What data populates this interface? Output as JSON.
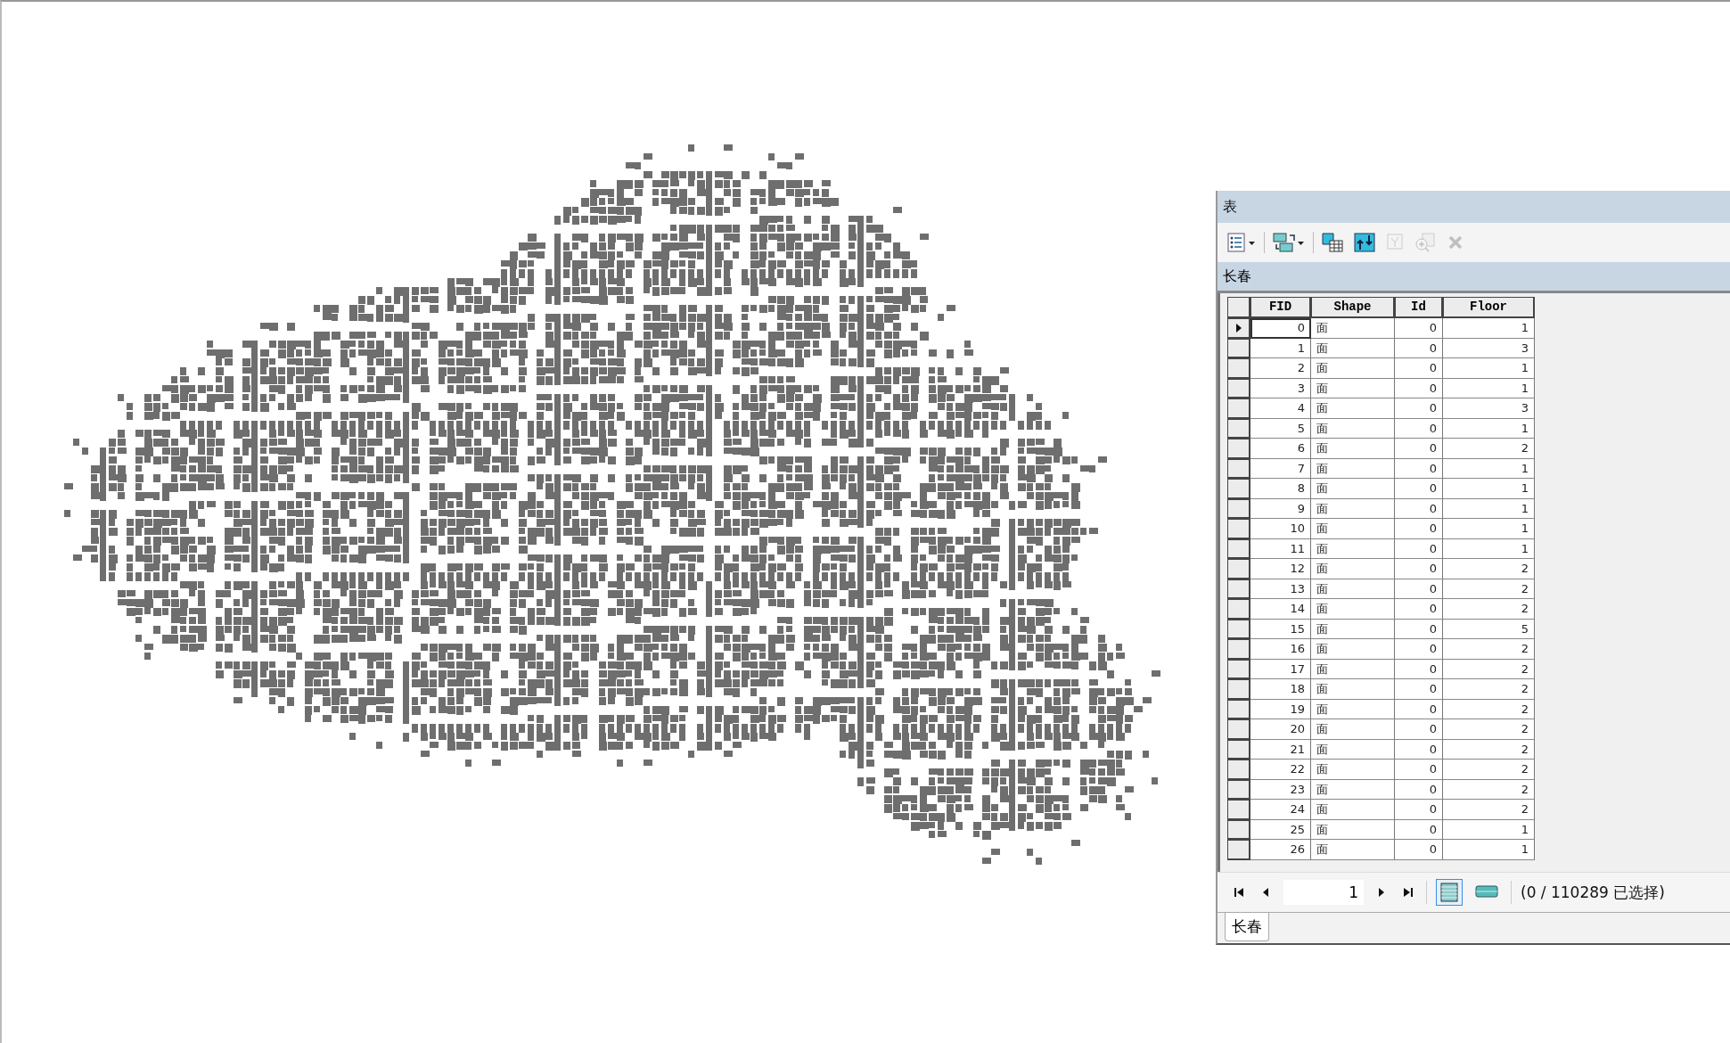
{
  "table_window": {
    "title": "表",
    "toolbar": [
      {
        "kind": "options",
        "disabled": false
      },
      {
        "kind": "related",
        "disabled": false
      },
      {
        "kind": "select_by_attributes",
        "disabled": false
      },
      {
        "kind": "switch_selection",
        "disabled": false
      },
      {
        "kind": "clear_selection",
        "disabled": true
      },
      {
        "kind": "zoom_selected",
        "disabled": true
      },
      {
        "kind": "delete_selected",
        "disabled": true
      }
    ],
    "table_name": "长春",
    "columns": [
      "FID",
      "Shape",
      "Id",
      "Floor"
    ],
    "rows": [
      {
        "fid": "0",
        "shape": "面",
        "id": "0",
        "floor": "1",
        "selected": true
      },
      {
        "fid": "1",
        "shape": "面",
        "id": "0",
        "floor": "3",
        "selected": false
      },
      {
        "fid": "2",
        "shape": "面",
        "id": "0",
        "floor": "1",
        "selected": false
      },
      {
        "fid": "3",
        "shape": "面",
        "id": "0",
        "floor": "1",
        "selected": false
      },
      {
        "fid": "4",
        "shape": "面",
        "id": "0",
        "floor": "3",
        "selected": false
      },
      {
        "fid": "5",
        "shape": "面",
        "id": "0",
        "floor": "1",
        "selected": false
      },
      {
        "fid": "6",
        "shape": "面",
        "id": "0",
        "floor": "2",
        "selected": false
      },
      {
        "fid": "7",
        "shape": "面",
        "id": "0",
        "floor": "1",
        "selected": false
      },
      {
        "fid": "8",
        "shape": "面",
        "id": "0",
        "floor": "1",
        "selected": false
      },
      {
        "fid": "9",
        "shape": "面",
        "id": "0",
        "floor": "1",
        "selected": false
      },
      {
        "fid": "10",
        "shape": "面",
        "id": "0",
        "floor": "1",
        "selected": false
      },
      {
        "fid": "11",
        "shape": "面",
        "id": "0",
        "floor": "1",
        "selected": false
      },
      {
        "fid": "12",
        "shape": "面",
        "id": "0",
        "floor": "2",
        "selected": false
      },
      {
        "fid": "13",
        "shape": "面",
        "id": "0",
        "floor": "2",
        "selected": false
      },
      {
        "fid": "14",
        "shape": "面",
        "id": "0",
        "floor": "2",
        "selected": false
      },
      {
        "fid": "15",
        "shape": "面",
        "id": "0",
        "floor": "5",
        "selected": false
      },
      {
        "fid": "16",
        "shape": "面",
        "id": "0",
        "floor": "2",
        "selected": false
      },
      {
        "fid": "17",
        "shape": "面",
        "id": "0",
        "floor": "2",
        "selected": false
      },
      {
        "fid": "18",
        "shape": "面",
        "id": "0",
        "floor": "2",
        "selected": false
      },
      {
        "fid": "19",
        "shape": "面",
        "id": "0",
        "floor": "2",
        "selected": false
      },
      {
        "fid": "20",
        "shape": "面",
        "id": "0",
        "floor": "2",
        "selected": false
      },
      {
        "fid": "21",
        "shape": "面",
        "id": "0",
        "floor": "2",
        "selected": false
      },
      {
        "fid": "22",
        "shape": "面",
        "id": "0",
        "floor": "2",
        "selected": false
      },
      {
        "fid": "23",
        "shape": "面",
        "id": "0",
        "floor": "2",
        "selected": false
      },
      {
        "fid": "24",
        "shape": "面",
        "id": "0",
        "floor": "2",
        "selected": false
      },
      {
        "fid": "25",
        "shape": "面",
        "id": "0",
        "floor": "1",
        "selected": false
      },
      {
        "fid": "26",
        "shape": "面",
        "id": "0",
        "floor": "1",
        "selected": false
      }
    ],
    "record_field": {
      "value": "1"
    },
    "views": [
      {
        "kind": "all",
        "selected": true
      },
      {
        "kind": "selected",
        "selected": false
      }
    ],
    "status": "(0 / 110289 已选择)",
    "tabs": [
      {
        "label": "长春",
        "selected": true
      }
    ]
  }
}
